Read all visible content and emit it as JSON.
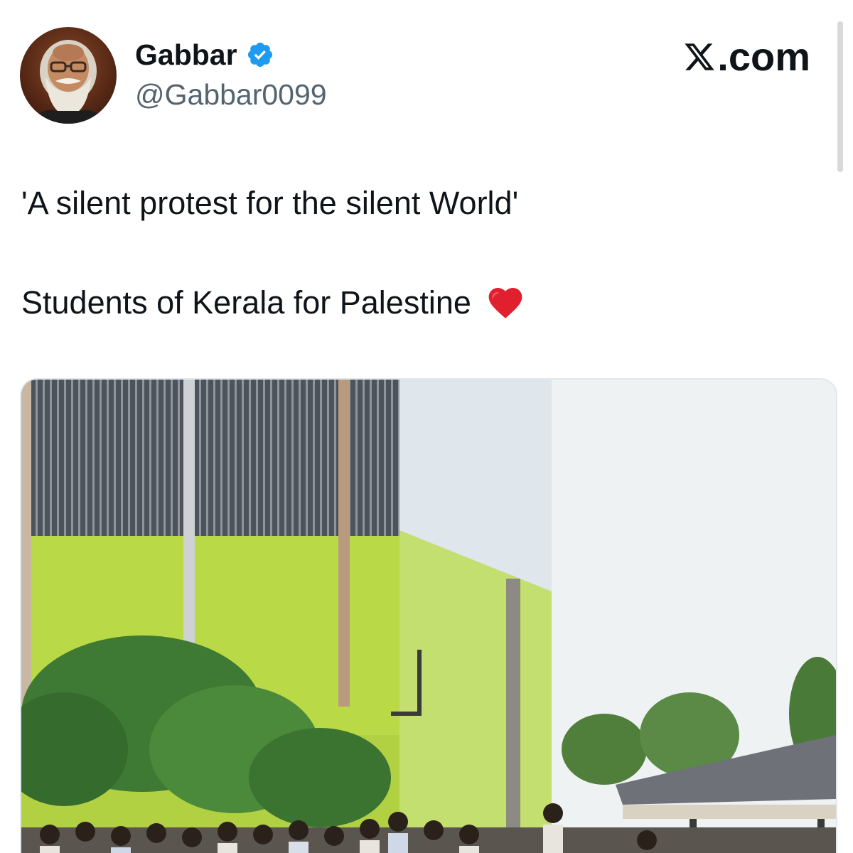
{
  "author": {
    "display_name": "Gabbar",
    "handle": "@Gabbar0099",
    "verified": true,
    "avatar_icon": "bearded-man-avatar"
  },
  "brand": {
    "logo_icon": "x-logo-icon",
    "domain_suffix": ".com"
  },
  "tweet": {
    "line_1": "'A silent protest for the silent World'",
    "line_2": "Students of Kerala for Palestine",
    "emoji_icon": "red-heart-icon"
  },
  "colors": {
    "verified_blue": "#1d9bf0",
    "heart_red": "#e0202f",
    "handle_gray": "#536471",
    "building_lime": "#bfe04a",
    "building_roof": "#4a5058"
  }
}
